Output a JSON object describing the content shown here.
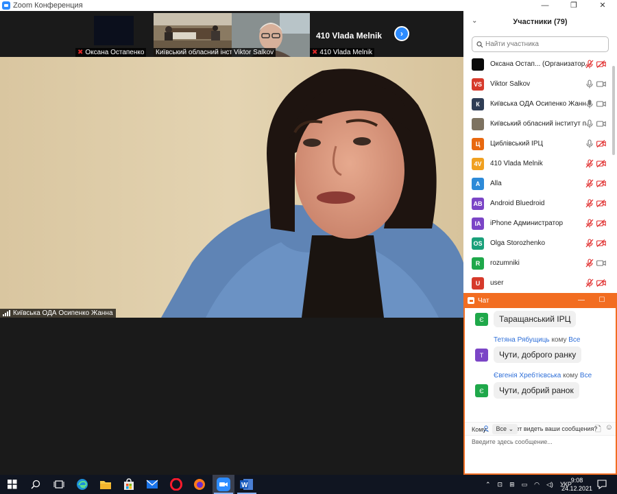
{
  "window": {
    "title": "Zoom Конференция",
    "min": "—",
    "restore": "❐",
    "close": "✕"
  },
  "thumbnails": [
    {
      "name": "Оксана Остапенко",
      "muted": true
    },
    {
      "name": "Київський обласний інст...",
      "muted": false
    },
    {
      "name": "Viktor Salkov",
      "muted": false
    },
    {
      "name": "410 Vlada Melnik",
      "muted": true,
      "big_label": "410 Vlada Melnik"
    }
  ],
  "main_video": {
    "speaker_name": "Київська ОДА Осипенко Жанна"
  },
  "participants": {
    "header": "Участники (79)",
    "search_placeholder": "Найти участника",
    "items": [
      {
        "initials": "",
        "color": "#0a0a0a",
        "name": "Оксана Остап... (Организатор, я)",
        "mic": "muted",
        "cam": "off"
      },
      {
        "initials": "VS",
        "color": "#d63a2b",
        "name": "Viktor Salkov",
        "mic": "on",
        "cam": "on"
      },
      {
        "initials": "К",
        "color": "#2f3d55",
        "name": "Київська ОДА Осипенко Жанна",
        "mic": "active",
        "cam": "on"
      },
      {
        "initials": "",
        "color": "#7d7260",
        "name": "Київський обласний інститут пі...",
        "mic": "on",
        "cam": "on"
      },
      {
        "initials": "Ц",
        "color": "#e8680f",
        "name": "Циблівський ІРЦ",
        "mic": "on",
        "cam": "off"
      },
      {
        "initials": "4V",
        "color": "#f0a020",
        "name": "410 Vlada Melnik",
        "mic": "muted",
        "cam": "off"
      },
      {
        "initials": "A",
        "color": "#2d8ad8",
        "name": "Alla",
        "mic": "muted",
        "cam": "off"
      },
      {
        "initials": "AB",
        "color": "#7b45c6",
        "name": "Android Bluedroid",
        "mic": "muted",
        "cam": "off"
      },
      {
        "initials": "IA",
        "color": "#7b45c6",
        "name": "iPhone Администратор",
        "mic": "muted",
        "cam": "off"
      },
      {
        "initials": "OS",
        "color": "#1aa07a",
        "name": "Olga  Storozhenko",
        "mic": "muted",
        "cam": "off"
      },
      {
        "initials": "R",
        "color": "#1fa84a",
        "name": "rozumniki",
        "mic": "muted",
        "cam": "on"
      },
      {
        "initials": "U",
        "color": "#d63a2b",
        "name": "user",
        "mic": "muted",
        "cam": "off"
      }
    ]
  },
  "chat": {
    "title": "Чат",
    "messages": [
      {
        "avatar": "Є",
        "color": "#1fa84a",
        "sender": "",
        "to_label": "",
        "to": "",
        "text": "Таращанський ІРЦ"
      },
      {
        "avatar": "Т",
        "color": "#7b45c6",
        "sender": "Тетяна Рябущиць",
        "to_label": "кому",
        "to": "Все",
        "text": "Чути, доброго ранку"
      },
      {
        "avatar": "Є",
        "color": "#1fa84a",
        "sender": "Євгенія Хребтієвська",
        "to_label": "кому",
        "to": "Все",
        "text": "Чути, добрий ранок"
      }
    ],
    "who_can_see": "Кто может видеть ваши сообщения?",
    "to_label": "Кому:",
    "to_value": "Все",
    "compose_placeholder": "Введите здесь сообщение..."
  },
  "taskbar": {
    "language": "УКР",
    "time": "9:08",
    "date": "24.12.2021"
  }
}
